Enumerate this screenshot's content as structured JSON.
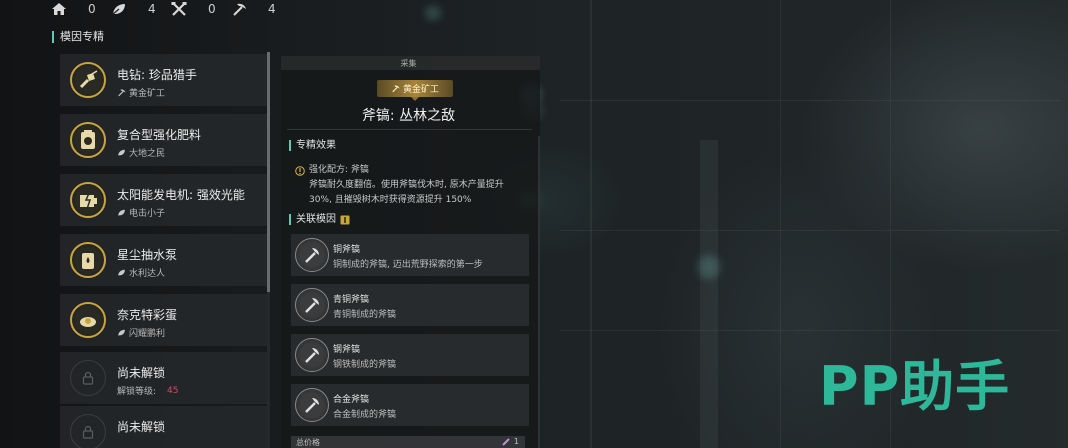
{
  "resources": [
    {
      "icon": "home-icon",
      "value": "0"
    },
    {
      "icon": "leaf-icon",
      "value": "4"
    },
    {
      "icon": "tools-icon",
      "value": "0"
    },
    {
      "icon": "pickaxe-icon",
      "value": "4"
    }
  ],
  "section_title": "模因专精",
  "list": [
    {
      "title": "电钻: 珍品猎手",
      "sub_icon": "pickaxe-icon",
      "sub": "黄金矿工",
      "icon": "drill-icon"
    },
    {
      "title": "复合型强化肥料",
      "sub_icon": "leaf-icon",
      "sub": "大地之民",
      "icon": "fertilizer-icon"
    },
    {
      "title": "太阳能发电机: 强效光能",
      "sub_icon": "leaf-icon",
      "sub": "电击小子",
      "icon": "solar-generator-icon"
    },
    {
      "title": "星尘抽水泵",
      "sub_icon": "leaf-icon",
      "sub": "水利达人",
      "icon": "water-pump-icon"
    },
    {
      "title": "奈克特彩蛋",
      "sub_icon": "leaf-icon",
      "sub": "闪耀鹏利",
      "icon": "egg-icon"
    },
    {
      "title": "尚未解锁",
      "sub": "解锁等级:",
      "level": "45",
      "icon": "lock-icon"
    },
    {
      "title": "尚未解锁",
      "icon": "lock-icon"
    }
  ],
  "detail": {
    "category": "采集",
    "tag": "黄金矿工",
    "title": "斧镐: 丛林之敌",
    "effect_heading": "专精效果",
    "effect_line1": "强化配方: 斧镐",
    "effect_line2": "斧镐耐久度翻倍。使用斧镐伐木时, 原木产量提升",
    "effect_line3": "30%, 且摧毁树木时获得资源提升 150%",
    "related_heading": "关联模因",
    "genes": [
      {
        "name": "铜斧镐",
        "desc": "铜制成的斧镐, 迈出荒野探索的第一步"
      },
      {
        "name": "青铜斧镐",
        "desc": "青铜制成的斧镐"
      },
      {
        "name": "钢斧镐",
        "desc": "钢铁制成的斧镐"
      },
      {
        "name": "合金斧镐",
        "desc": "合金制成的斧镐"
      }
    ],
    "total_label": "总价格",
    "total_value": "1"
  },
  "watermark": "PP助手",
  "colors": {
    "accent": "#5fc9b8",
    "gold": "#c9a53f",
    "lock_level": "#d24d55",
    "watermark": "#2db89a"
  }
}
